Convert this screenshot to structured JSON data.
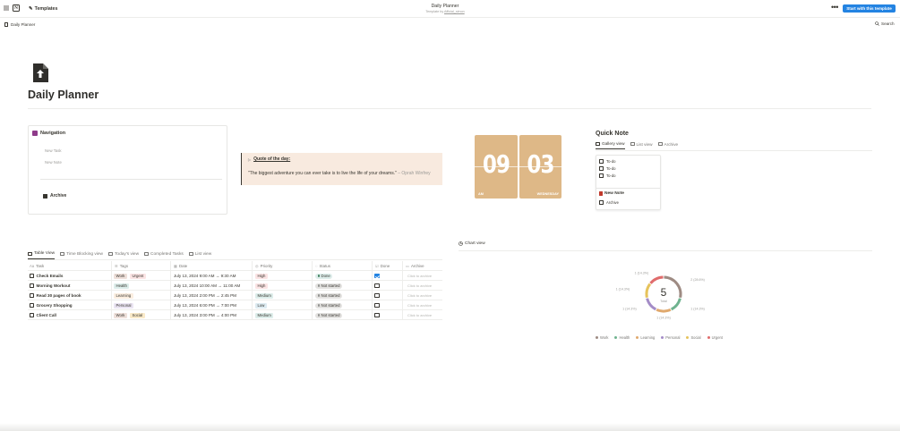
{
  "topbar": {
    "templates_label": "Templates",
    "page_title": "Daily Planner",
    "template_by_prefix": "Template by ",
    "template_author": "Afficial_simon",
    "start_button": "Start with this template"
  },
  "breadcrumb": {
    "label": "Daily Planner",
    "search": "Search"
  },
  "page": {
    "title": "Daily Planner"
  },
  "navigation": {
    "title": "Navigation",
    "items": [
      "New Task",
      "New Note"
    ],
    "archive": "Archive"
  },
  "quote": {
    "title": "Quote of the day:",
    "text": "\"The biggest adventure you can ever take is to live the life of your dreams.\"",
    "author": " – Oprah Winfrey"
  },
  "clock": {
    "hour": "09",
    "minute": "03",
    "ampm": "AM",
    "weekday": "WEDNESDAY",
    "color": "#deb887"
  },
  "quick_note": {
    "title": "Quick Note",
    "tabs": [
      "Gallery view",
      "List view",
      "Archive"
    ],
    "todos": [
      "To-do",
      "To-do",
      "To-do"
    ],
    "new_note": "New Note",
    "archive": "Archive"
  },
  "table": {
    "tabs": [
      "Table View",
      "Time Blocking view",
      "Today's view",
      "Completed Tasks",
      "List view"
    ],
    "columns": [
      "Task",
      "Tags",
      "Date",
      "Priority",
      "Status",
      "Done",
      "Archive"
    ],
    "rows": [
      {
        "task": "Check Emails",
        "tags": [
          "Work",
          "Urgent"
        ],
        "date": "July 13, 2024 9:00 AM → 9:30 AM",
        "priority": "High",
        "status": "Done",
        "done": true,
        "archive": "Click to archive"
      },
      {
        "task": "Morning Workout",
        "tags": [
          "Health"
        ],
        "date": "July 13, 2024 10:00 AM → 11:00 AM",
        "priority": "High",
        "status": "Not started",
        "done": false,
        "archive": "Click to archive"
      },
      {
        "task": "Read 30 pages of book",
        "tags": [
          "Learning"
        ],
        "date": "July 13, 2024 2:00 PM → 2:45 PM",
        "priority": "Medium",
        "status": "Not started",
        "done": false,
        "archive": "Click to archive"
      },
      {
        "task": "Grocery Shopping",
        "tags": [
          "Personal"
        ],
        "date": "July 13, 2024 6:00 PM → 7:00 PM",
        "priority": "Low",
        "status": "Not started",
        "done": false,
        "archive": "Click to archive"
      },
      {
        "task": "Client Call",
        "tags": [
          "Work",
          "Social"
        ],
        "date": "July 13, 2024 3:00 PM → 4:00 PM",
        "priority": "Medium",
        "status": "Not started",
        "done": false,
        "archive": "Click to archive"
      }
    ],
    "tag_colors": {
      "Work": "#eee0da",
      "Urgent": "#fbe4e4",
      "Health": "#ddedea",
      "Learning": "#fbeee0",
      "Personal": "#eae4f2",
      "Social": "#f9e9c8"
    },
    "priority_colors": {
      "High": "#fbe4e4",
      "Medium": "#ddedea",
      "Low": "#ddebf1"
    },
    "status_colors": {
      "Done": "#ddedea",
      "Not started": "#e3e2e0"
    },
    "status_dot_colors": {
      "Done": "#448361",
      "Not started": "#91918e"
    }
  },
  "chart_view_label": "Chart view",
  "chart_data": {
    "type": "pie",
    "center_value": "5",
    "center_label": "Total",
    "categories": [
      "Work",
      "Health",
      "Learning",
      "Personal",
      "Social",
      "Urgent"
    ],
    "values": [
      2,
      1,
      1,
      1,
      1,
      1
    ],
    "slice_labels": [
      "2 (28.6%)",
      "1 (14.3%)",
      "1 (14.3%)",
      "1 (14.3%)",
      "1 (14.3%)",
      "1 (14.3%)"
    ],
    "colors": [
      "#9e8b83",
      "#6fb38f",
      "#e0a96d",
      "#a48cc7",
      "#e6c35c",
      "#e06c6c"
    ],
    "legend": "bottom"
  }
}
